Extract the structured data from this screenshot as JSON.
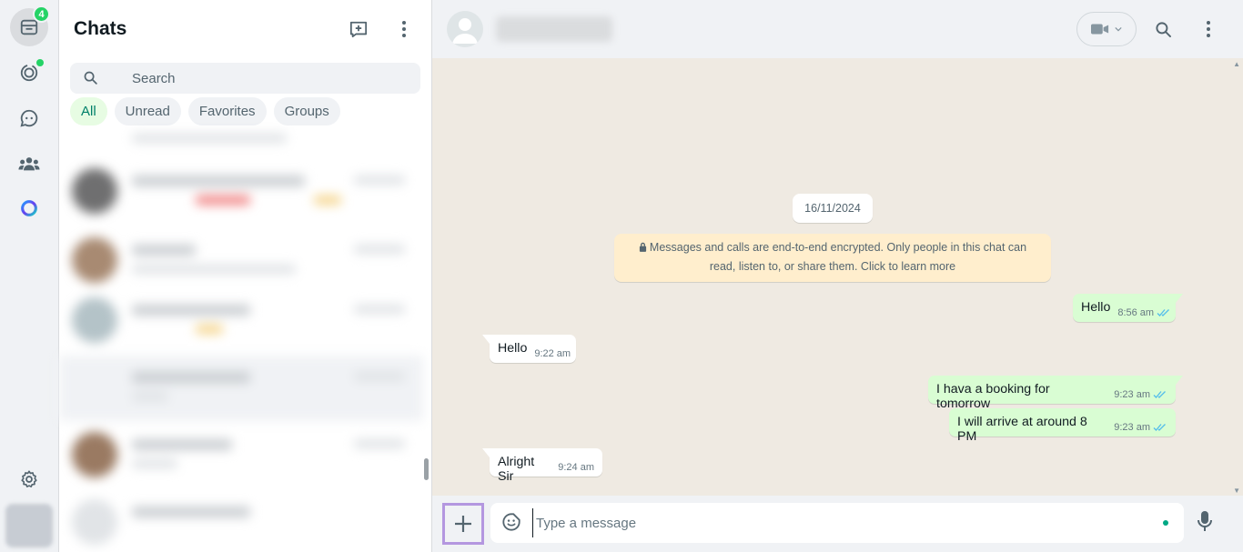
{
  "nav": {
    "chats_badge": "4",
    "items": [
      "chats-icon",
      "status-icon",
      "channels-icon",
      "communities-icon",
      "meta-ai-icon",
      "settings-icon"
    ]
  },
  "sidebar": {
    "title": "Chats",
    "search_placeholder": "Search",
    "filters": [
      {
        "label": "All",
        "active": true
      },
      {
        "label": "Unread"
      },
      {
        "label": "Favorites"
      },
      {
        "label": "Groups"
      }
    ]
  },
  "conversation": {
    "date": "16/11/2024",
    "encryption_notice": "Messages and calls are end-to-end encrypted. Only people in this chat can read, listen to, or share them. Click to learn more",
    "messages": [
      {
        "direction": "out",
        "text": "Hello",
        "time": "8:56 am",
        "status": "read"
      },
      {
        "direction": "in",
        "text": "Hello",
        "time": "9:22 am"
      },
      {
        "direction": "out",
        "text": "I hava a booking for tomorrow",
        "time": "9:23 am",
        "status": "read"
      },
      {
        "direction": "out",
        "text": "I will arrive at around 8 PM",
        "time": "9:23 am",
        "status": "read"
      },
      {
        "direction": "in",
        "text": "Alright Sir",
        "time": "9:24 am"
      }
    ]
  },
  "composer": {
    "placeholder": "Type a message"
  },
  "colors": {
    "accent": "#25d366",
    "outgoing_bubble": "#d9fdd3",
    "chat_background": "#efeae2",
    "read_ticks": "#53bdeb"
  }
}
